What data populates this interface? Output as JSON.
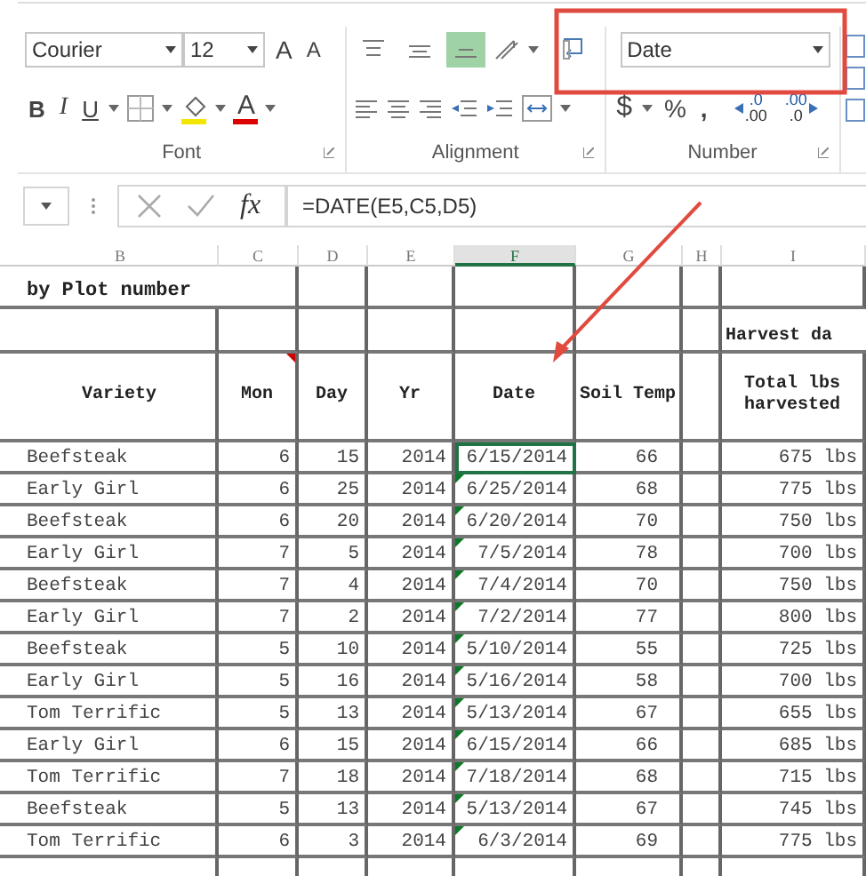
{
  "ribbon": {
    "font": {
      "name": "Courier",
      "size": "12",
      "grow_label": "A",
      "shrink_label": "A",
      "style_buttons": [
        {
          "kind": "bold",
          "label": "B"
        },
        {
          "kind": "italic",
          "label": "I"
        },
        {
          "kind": "underline",
          "label": "U"
        }
      ],
      "color_label": "A",
      "group_label": "Font"
    },
    "alignment": {
      "top_buttons": [
        {
          "kind": "top",
          "selected": false
        },
        {
          "kind": "middle",
          "selected": false
        },
        {
          "kind": "bottom",
          "selected": true
        }
      ],
      "group_label": "Alignment"
    },
    "number": {
      "format": "Date",
      "currency_label": "$",
      "percent_label": "%",
      "comma_label": ",",
      "decimals": [
        {
          "kind": "increase",
          "top": ".0",
          "bottom": ".00"
        },
        {
          "kind": "decrease",
          "top": ".00",
          "bottom": ".0"
        }
      ],
      "group_label": "Number"
    }
  },
  "formula_bar": {
    "fx_label": "fx",
    "formula": "=DATE(E5,C5,D5)"
  },
  "columns": [
    {
      "letter": "B",
      "selected": false
    },
    {
      "letter": "C",
      "selected": false
    },
    {
      "letter": "D",
      "selected": false
    },
    {
      "letter": "E",
      "selected": false
    },
    {
      "letter": "F",
      "selected": true
    },
    {
      "letter": "G",
      "selected": false
    },
    {
      "letter": "H",
      "selected": false
    },
    {
      "letter": "I",
      "selected": false
    }
  ],
  "sheet_title": "by Plot number",
  "group_heading": "Harvest da",
  "headers": [
    {
      "text": "Variety",
      "comment": false
    },
    {
      "text": "Mon",
      "comment": true
    },
    {
      "text": "Day",
      "comment": false
    },
    {
      "text": "Yr",
      "comment": false
    },
    {
      "text": "Date",
      "comment": false
    },
    {
      "text": "Soil Temp",
      "comment": false
    },
    {
      "comment": false
    },
    {
      "text": "Total lbs harvested",
      "comment": false
    }
  ],
  "rows": [
    {
      "variety": "Beefsteak",
      "mon": "6",
      "day": "15",
      "yr": "2014",
      "date": "6/15/2014",
      "date_selected": true,
      "date_flag": false,
      "soil": "66",
      "lbs": "675 lbs"
    },
    {
      "variety": "Early Girl",
      "mon": "6",
      "day": "25",
      "yr": "2014",
      "date": "6/25/2014",
      "date_selected": false,
      "date_flag": true,
      "soil": "68",
      "lbs": "775 lbs"
    },
    {
      "variety": "Beefsteak",
      "mon": "6",
      "day": "20",
      "yr": "2014",
      "date": "6/20/2014",
      "date_selected": false,
      "date_flag": true,
      "soil": "70",
      "lbs": "750 lbs"
    },
    {
      "variety": "Early Girl",
      "mon": "7",
      "day": "5",
      "yr": "2014",
      "date": "7/5/2014",
      "date_selected": false,
      "date_flag": true,
      "soil": "78",
      "lbs": "700 lbs"
    },
    {
      "variety": "Beefsteak",
      "mon": "7",
      "day": "4",
      "yr": "2014",
      "date": "7/4/2014",
      "date_selected": false,
      "date_flag": true,
      "soil": "70",
      "lbs": "750 lbs"
    },
    {
      "variety": "Early Girl",
      "mon": "7",
      "day": "2",
      "yr": "2014",
      "date": "7/2/2014",
      "date_selected": false,
      "date_flag": true,
      "soil": "77",
      "lbs": "800 lbs"
    },
    {
      "variety": "Beefsteak",
      "mon": "5",
      "day": "10",
      "yr": "2014",
      "date": "5/10/2014",
      "date_selected": false,
      "date_flag": true,
      "soil": "55",
      "lbs": "725 lbs"
    },
    {
      "variety": "Early Girl",
      "mon": "5",
      "day": "16",
      "yr": "2014",
      "date": "5/16/2014",
      "date_selected": false,
      "date_flag": true,
      "soil": "58",
      "lbs": "700 lbs"
    },
    {
      "variety": "Tom Terrific",
      "mon": "5",
      "day": "13",
      "yr": "2014",
      "date": "5/13/2014",
      "date_selected": false,
      "date_flag": true,
      "soil": "67",
      "lbs": "655 lbs"
    },
    {
      "variety": "Early Girl",
      "mon": "6",
      "day": "15",
      "yr": "2014",
      "date": "6/15/2014",
      "date_selected": false,
      "date_flag": true,
      "soil": "66",
      "lbs": "685 lbs"
    },
    {
      "variety": "Tom Terrific",
      "mon": "7",
      "day": "18",
      "yr": "2014",
      "date": "7/18/2014",
      "date_selected": false,
      "date_flag": true,
      "soil": "68",
      "lbs": "715 lbs"
    },
    {
      "variety": "Beefsteak",
      "mon": "5",
      "day": "13",
      "yr": "2014",
      "date": "5/13/2014",
      "date_selected": false,
      "date_flag": true,
      "soil": "67",
      "lbs": "745 lbs"
    },
    {
      "variety": "Tom Terrific",
      "mon": "6",
      "day": "3",
      "yr": "2014",
      "date": "6/3/2014",
      "date_selected": false,
      "date_flag": true,
      "soil": "69",
      "lbs": "775 lbs"
    }
  ]
}
